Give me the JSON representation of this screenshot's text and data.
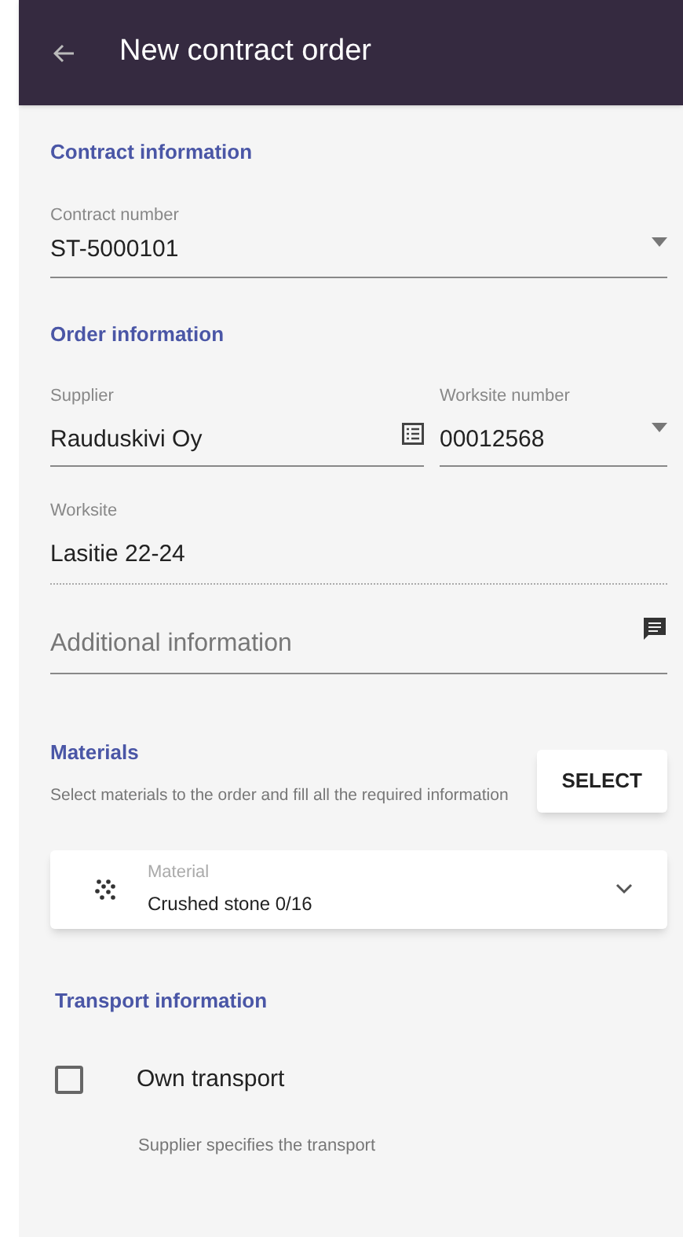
{
  "app_bar": {
    "title": "New contract order"
  },
  "contract_section": {
    "heading": "Contract information",
    "contract_number": {
      "label": "Contract number",
      "value": "ST-5000101"
    }
  },
  "order_section": {
    "heading": "Order information",
    "supplier": {
      "label": "Supplier",
      "value": "Rauduskivi Oy"
    },
    "worksite_number": {
      "label": "Worksite number",
      "value": "00012568"
    },
    "worksite": {
      "label": "Worksite",
      "value": "Lasitie 22-24"
    },
    "additional_information": {
      "placeholder": "Additional information"
    }
  },
  "materials_section": {
    "heading": "Materials",
    "description": "Select materials to the order and fill all the required information",
    "select_button": "SELECT",
    "items": [
      {
        "label": "Material",
        "value": "Crushed stone 0/16",
        "expanded": false
      }
    ]
  },
  "transport_section": {
    "heading": "Transport information",
    "own_transport": {
      "label": "Own transport",
      "checked": false
    },
    "note": "Supplier specifies the transport"
  }
}
